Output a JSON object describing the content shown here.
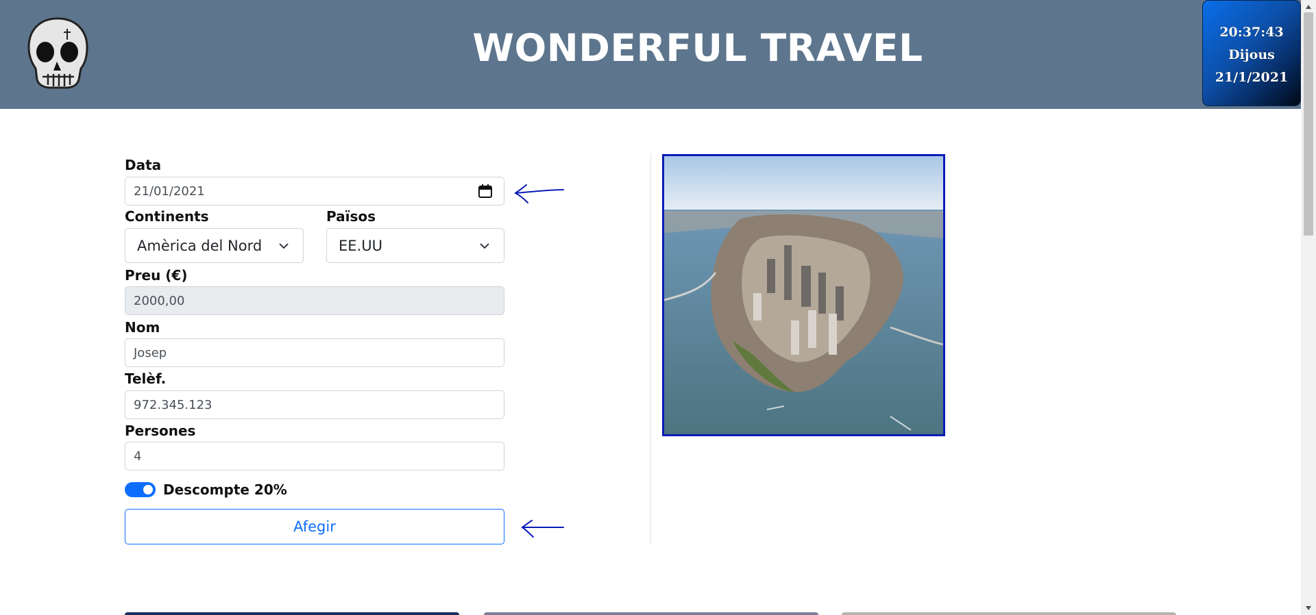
{
  "header": {
    "title": "WONDERFUL TRAVEL",
    "background_color": "#5d758d",
    "logo_icon": "skull-icon"
  },
  "clock": {
    "time": "20:37:43",
    "weekday": "Dijous",
    "date": "21/1/2021"
  },
  "form": {
    "date": {
      "label": "Data",
      "value": "21/01/2021",
      "icon": "calendar-icon"
    },
    "continents": {
      "label": "Continents",
      "selected": "Amèrica del Nord"
    },
    "countries": {
      "label": "Països",
      "selected": "EE.UU"
    },
    "price": {
      "label": "Preu (€)",
      "value": "2000,00"
    },
    "name": {
      "label": "Nom",
      "value": "Josep"
    },
    "phone": {
      "label": "Telèf.",
      "value": "972.345.123"
    },
    "people": {
      "label": "Persones",
      "value": "4"
    },
    "discount": {
      "label": "Descompte 20%",
      "enabled": true
    },
    "submit_label": "Afegir"
  },
  "colors": {
    "accent": "#0d6efd",
    "annotation_arrows": "#0a1bb8",
    "photo_border": "#0a1bb8"
  }
}
